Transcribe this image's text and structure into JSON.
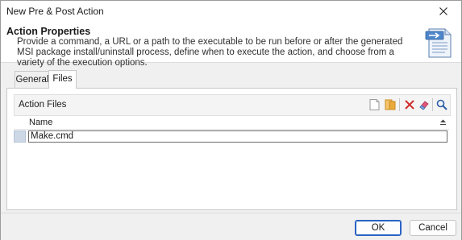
{
  "window": {
    "title": "New Pre & Post Action"
  },
  "header": {
    "title": "Action Properties",
    "description": "Provide a command, a URL or a path to the executable to be run before or after the generated MSI package install/uninstall process, define when to execute the action, and choose from a variety of the execution options.",
    "icon": "document-arrow-icon"
  },
  "tabs": [
    {
      "label": "General",
      "active": false
    },
    {
      "label": "Files",
      "active": true
    }
  ],
  "action_files": {
    "label": "Action Files",
    "toolbar": [
      "new-file-icon",
      "add-folder-icon",
      "delete-icon",
      "clear-icon",
      "search-icon"
    ],
    "column_name": "Name",
    "rows": [
      {
        "name": "Make.cmd"
      }
    ]
  },
  "buttons": {
    "ok": "OK",
    "cancel": "Cancel"
  },
  "colors": {
    "accent": "#2b63c4",
    "delete": "#d02a2a"
  }
}
